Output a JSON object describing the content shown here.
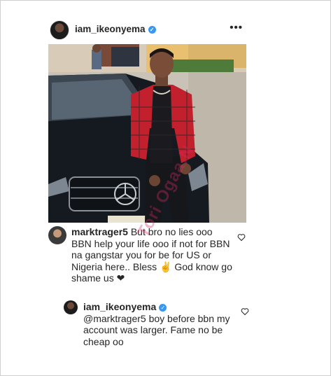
{
  "post": {
    "username": "iam_ikeonyema",
    "more_label": "•••"
  },
  "comments": [
    {
      "username": "marktrager5",
      "text": " But bro no lies ooo BBN help your life ooo if not for BBN na gangstar  you for be for US or Nigeria here.. Bless ✌ God know go shame us ❤"
    },
    {
      "username": "iam_ikeonyema",
      "mention": "@marktrager5",
      "text": " boy before bbn my account was larger. Fame no be cheap oo"
    }
  ],
  "watermark": "Tori Ogaa.N",
  "colors": {
    "verified": "#3897f0",
    "text": "#262626"
  }
}
